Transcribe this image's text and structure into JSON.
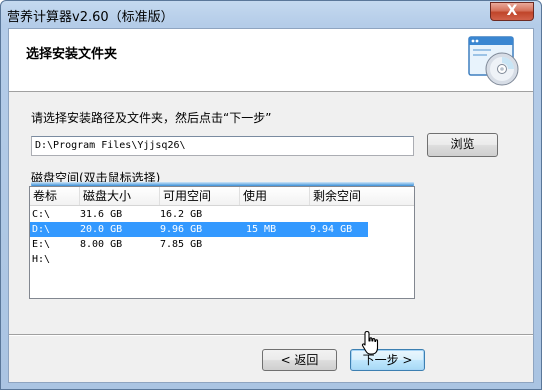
{
  "window": {
    "title": "营养计算器v2.60（标准版）",
    "close_label": "X"
  },
  "header": {
    "title": "选择安装文件夹",
    "icon": "cd-install-icon"
  },
  "instruction": "请选择安装路径及文件夹，然后点击“下一步”",
  "path_input": {
    "value": "D:\\Program Files\\Yjjsq26\\"
  },
  "browse_label": "浏览",
  "disk_space_label": "磁盘空间(双击鼠标选择)",
  "disk_list": {
    "columns": [
      "卷标",
      "磁盘大小",
      "可用空间",
      "使用",
      "剩余空间"
    ],
    "rows": [
      {
        "cells": [
          "C:\\",
          "31.6 GB",
          "16.2 GB",
          "",
          ""
        ],
        "selected": false
      },
      {
        "cells": [
          "D:\\",
          "20.0 GB",
          "9.96 GB",
          "15 MB",
          "9.94 GB"
        ],
        "selected": true
      },
      {
        "cells": [
          "E:\\",
          "8.00 GB",
          "7.85 GB",
          "",
          ""
        ],
        "selected": false
      },
      {
        "cells": [
          "H:\\",
          "",
          "",
          "",
          ""
        ],
        "selected": false
      }
    ]
  },
  "buttons": {
    "back_label": "< 返回",
    "next_label": "下一步 >"
  },
  "colors": {
    "selection": "#3399ff",
    "titlebar": "#b9d1ea",
    "close": "#c7432b"
  }
}
